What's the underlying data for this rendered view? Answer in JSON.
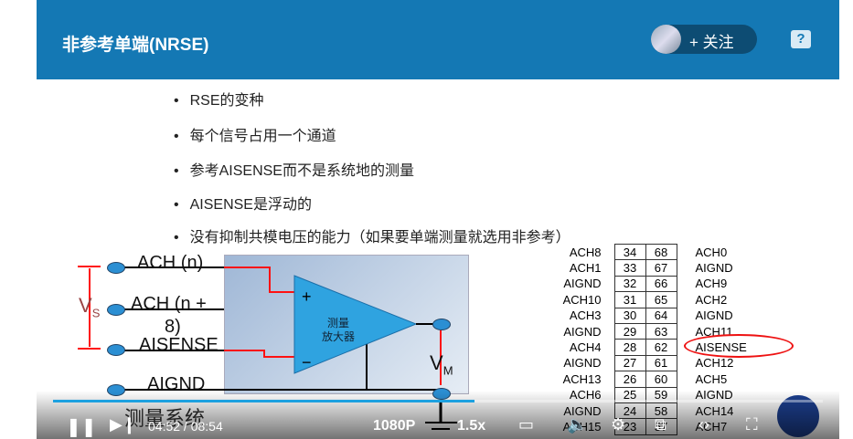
{
  "header": {
    "title": "非参考单端(NRSE)",
    "follow_label": "+ 关注",
    "help_icon": "?"
  },
  "bullets": [
    "RSE的变种",
    "每个信号占用一个通道",
    "参考AISENSE而不是系统地的测量",
    "AISENSE是浮动的",
    "没有抑制共模电压的能力（如果要单端测量就选用非参考）"
  ],
  "diagram": {
    "terminals": [
      "ACH (n)",
      "ACH (n +",
      "8)",
      "AISENSE",
      "AIGND"
    ],
    "vs": "V",
    "vs_sub": "S",
    "vm": "V",
    "vm_sub": "M",
    "amp_line1": "测量",
    "amp_line2": "放大器",
    "plus": "+",
    "minus": "−",
    "system": "测量系统"
  },
  "pins": [
    [
      "ACH8",
      "34",
      "68",
      "ACH0"
    ],
    [
      "ACH1",
      "33",
      "67",
      "AIGND"
    ],
    [
      "AIGND",
      "32",
      "66",
      "ACH9"
    ],
    [
      "ACH10",
      "31",
      "65",
      "ACH2"
    ],
    [
      "ACH3",
      "30",
      "64",
      "AIGND"
    ],
    [
      "AIGND",
      "29",
      "63",
      "ACH11"
    ],
    [
      "ACH4",
      "28",
      "62",
      "AISENSE"
    ],
    [
      "AIGND",
      "27",
      "61",
      "ACH12"
    ],
    [
      "ACH13",
      "26",
      "60",
      "ACH5"
    ],
    [
      "ACH6",
      "25",
      "59",
      "AIGND"
    ],
    [
      "AIGND",
      "24",
      "58",
      "ACH14"
    ],
    [
      "ACH15",
      "23",
      "57",
      "ACH7"
    ]
  ],
  "player": {
    "time": "04:52 / 08:54",
    "quality": "1080P",
    "speed": "1.5x",
    "progress": 0.547,
    "accent": "#1da1e0"
  },
  "colors": {
    "header": "#1478b4",
    "wire_red": "#ff1a1a",
    "amp": "#2fa3e0"
  }
}
